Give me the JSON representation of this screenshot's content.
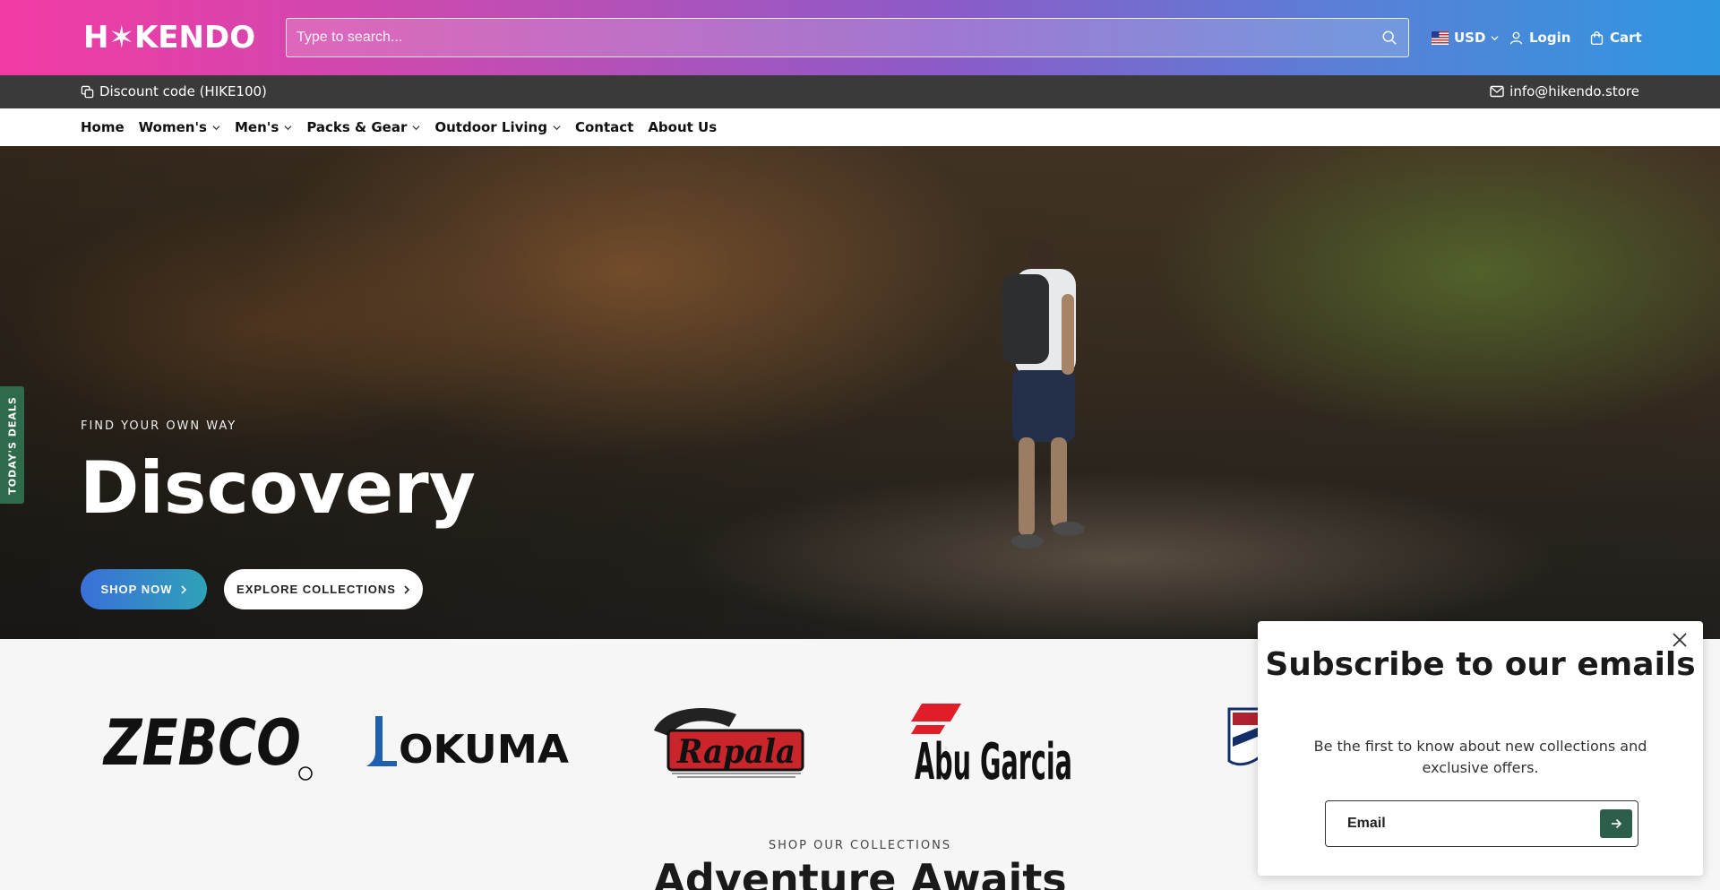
{
  "header": {
    "logo_text": "H✶KENDO",
    "search_placeholder": "Type to search...",
    "currency": "USD",
    "login_label": "Login",
    "cart_label": "Cart"
  },
  "announcement": {
    "discount_text": "Discount code (HIKE100)",
    "email_text": "info@hikendo.store"
  },
  "nav": {
    "items": [
      {
        "label": "Home",
        "has_dropdown": false
      },
      {
        "label": "Women's",
        "has_dropdown": true
      },
      {
        "label": "Men's",
        "has_dropdown": true
      },
      {
        "label": "Packs & Gear",
        "has_dropdown": true
      },
      {
        "label": "Outdoor Living",
        "has_dropdown": true
      },
      {
        "label": "Contact",
        "has_dropdown": false
      },
      {
        "label": "About Us",
        "has_dropdown": false
      }
    ]
  },
  "hero": {
    "eyebrow": "FIND YOUR OWN WAY",
    "title": "Discovery",
    "shop_now_label": "SHOP NOW",
    "explore_label": "EXPLORE COLLECTIONS"
  },
  "deals_tab": {
    "label": "TODAY'S DEALS"
  },
  "brands": [
    "ZEBCO",
    "OKUMA",
    "Rapala",
    "Abu Garcia"
  ],
  "collections": {
    "eyebrow": "SHOP OUR COLLECTIONS",
    "title": "Adventure Awaits"
  },
  "popup": {
    "title": "Subscribe to our emails",
    "description": "Be the first to know about new collections and exclusive offers.",
    "email_placeholder": "Email"
  },
  "colors": {
    "header_gradient_start": "#f23aa4",
    "header_gradient_end": "#2f97e0",
    "announcement_bg": "#3a3a3a",
    "deals_tab_bg": "#2d6b4a",
    "submit_bg": "#2d5e4a"
  }
}
